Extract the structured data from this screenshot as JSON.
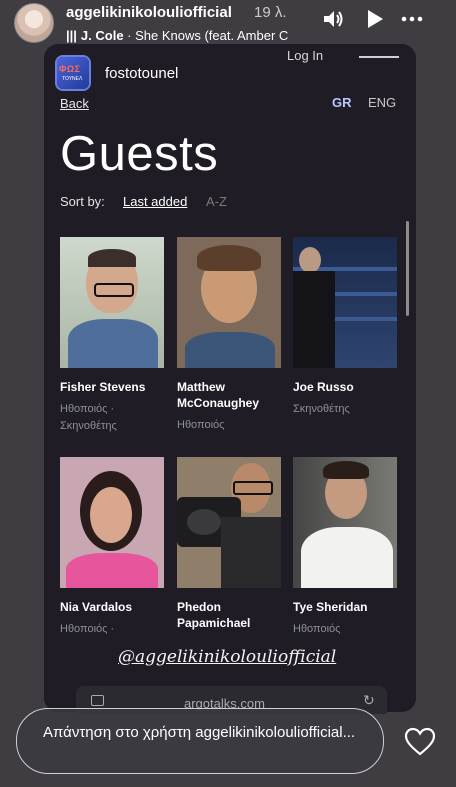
{
  "story": {
    "username": "aggelikinikolouliofficial",
    "age": "19 λ.",
    "music_bars": "|||",
    "music_artist": "J. Cole",
    "music_track": " · She Knows (feat. Amber C"
  },
  "site": {
    "login": "Log In",
    "logo_text": "ΦΩΣ",
    "logo_sub": "ΤΟΥΝΕΛ",
    "name": "fostotounel",
    "back": "Back",
    "lang_gr": "GR",
    "lang_en": "ENG",
    "title": "Guests",
    "sort_label": "Sort by:",
    "sort_last": "Last added",
    "sort_az": "A-Z",
    "url": "argotalks.com"
  },
  "guests": [
    {
      "name": "Fisher Stevens",
      "role": "Ηθοποιός · Σκηνοθέτης"
    },
    {
      "name": "Matthew McConaughey",
      "role": "Ηθοποιός"
    },
    {
      "name": "Joe Russo",
      "role": "Σκηνοθέτης"
    },
    {
      "name": "Nia Vardalos",
      "role": "Ηθοποιός ·"
    },
    {
      "name": "Phedon Papamichael",
      "role": ""
    },
    {
      "name": "Tye Sheridan",
      "role": "Ηθοποιός"
    }
  ],
  "watermark": "@aggelikinikolouliofficial",
  "reply_placeholder": "Απάντηση στο χρήστη aggelikinikolouliofficial...",
  "icons": [
    "sound-icon",
    "play-icon",
    "more-icon",
    "tab-icon",
    "reload-icon",
    "heart-icon"
  ],
  "colors": {
    "background": "#3f3c42",
    "panel": "#1f1c25",
    "accent": "#b9c7ff"
  }
}
